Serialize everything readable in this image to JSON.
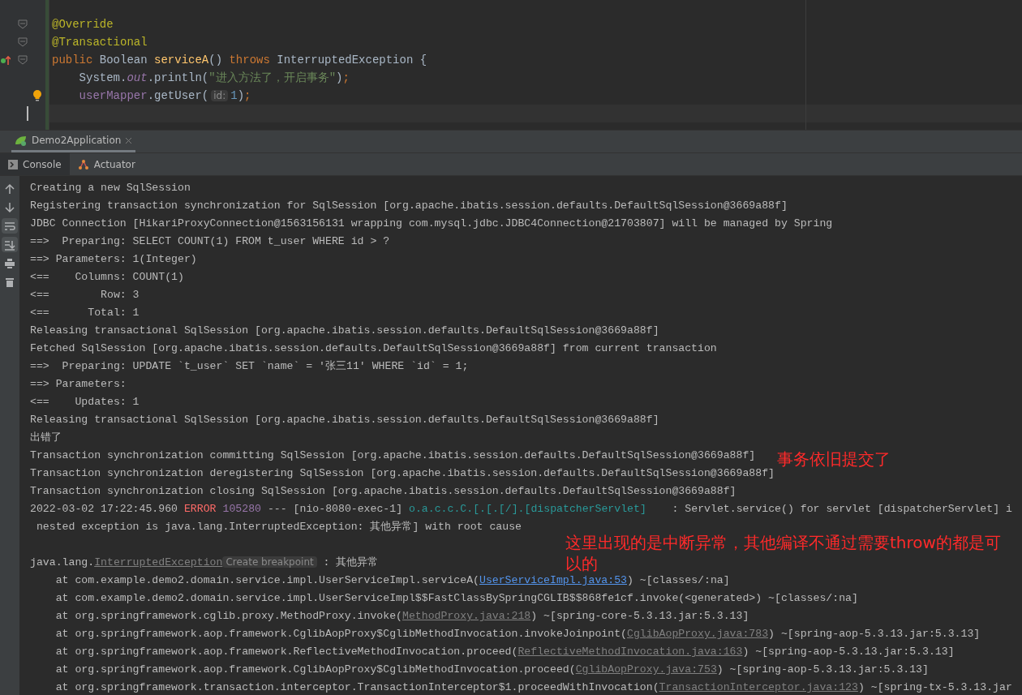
{
  "editor": {
    "lines": [
      {
        "fold": true,
        "current": false,
        "segments": [
          {
            "kind": "annotation",
            "text": "@Override"
          }
        ]
      },
      {
        "fold": true,
        "current": false,
        "segments": [
          {
            "kind": "annotation",
            "text": "@Transactional"
          }
        ]
      },
      {
        "override": true,
        "fold": true,
        "current": false,
        "segments": [
          {
            "kind": "keyword",
            "text": "public "
          },
          {
            "kind": "plain",
            "text": "Boolean "
          },
          {
            "kind": "method",
            "text": "serviceA"
          },
          {
            "kind": "plain",
            "text": "() "
          },
          {
            "kind": "keyword",
            "text": "throws "
          },
          {
            "kind": "plain",
            "text": "InterruptedException {"
          }
        ]
      },
      {
        "current": false,
        "segments": [
          {
            "kind": "plain",
            "text": "    System."
          },
          {
            "kind": "static",
            "text": "out"
          },
          {
            "kind": "plain",
            "text": ".println("
          },
          {
            "kind": "string",
            "text": "\"进入方法了，开启事务\""
          },
          {
            "kind": "plain",
            "text": ")"
          },
          {
            "kind": "keyword",
            "text": ";"
          }
        ]
      },
      {
        "bulb": true,
        "current": false,
        "segments": [
          {
            "kind": "member",
            "text": "    userMapper"
          },
          {
            "kind": "plain",
            "text": ".getUser("
          },
          {
            "kind": "hint",
            "text": "id:"
          },
          {
            "kind": "number",
            "text": "1"
          },
          {
            "kind": "plain",
            "text": ")"
          },
          {
            "kind": "keyword",
            "text": ";"
          }
        ]
      },
      {
        "current": true
      }
    ]
  },
  "run_tabs": [
    {
      "label": "Demo2Application",
      "selected": true
    }
  ],
  "tool_tabs": [
    {
      "label": "Console",
      "kind": "console",
      "selected": true
    },
    {
      "label": "Actuator",
      "kind": "actuator",
      "selected": false
    }
  ],
  "console_toolbar": [
    {
      "kind": "up",
      "on": false
    },
    {
      "kind": "down",
      "on": false
    },
    {
      "kind": "wrap",
      "on": true
    },
    {
      "kind": "scroll",
      "on": true
    },
    {
      "kind": "print",
      "on": false
    },
    {
      "kind": "trash",
      "on": false
    }
  ],
  "console_lines": [
    {
      "segments": [
        {
          "kind": "plain",
          "text": "Creating a new SqlSession"
        }
      ]
    },
    {
      "segments": [
        {
          "kind": "plain",
          "text": "Registering transaction synchronization for SqlSession [org.apache.ibatis.session.defaults.DefaultSqlSession@3669a88f]"
        }
      ]
    },
    {
      "segments": [
        {
          "kind": "plain",
          "text": "JDBC Connection [HikariProxyConnection@1563156131 wrapping com.mysql.jdbc.JDBC4Connection@21703807] will be managed by Spring"
        }
      ]
    },
    {
      "segments": [
        {
          "kind": "plain",
          "text": "==>  Preparing: SELECT COUNT(1) FROM t_user WHERE id > ?"
        }
      ]
    },
    {
      "segments": [
        {
          "kind": "plain",
          "text": "==> Parameters: 1(Integer)"
        }
      ]
    },
    {
      "segments": [
        {
          "kind": "plain",
          "text": "<==    Columns: COUNT(1)"
        }
      ]
    },
    {
      "segments": [
        {
          "kind": "plain",
          "text": "<==        Row: 3"
        }
      ]
    },
    {
      "segments": [
        {
          "kind": "plain",
          "text": "<==      Total: 1"
        }
      ]
    },
    {
      "segments": [
        {
          "kind": "plain",
          "text": "Releasing transactional SqlSession [org.apache.ibatis.session.defaults.DefaultSqlSession@3669a88f]"
        }
      ]
    },
    {
      "segments": [
        {
          "kind": "plain",
          "text": "Fetched SqlSession [org.apache.ibatis.session.defaults.DefaultSqlSession@3669a88f] from current transaction"
        }
      ]
    },
    {
      "segments": [
        {
          "kind": "plain",
          "text": "==>  Preparing: UPDATE `t_user` SET `name` = '张三11' WHERE `id` = 1;"
        }
      ]
    },
    {
      "segments": [
        {
          "kind": "plain",
          "text": "==> Parameters:"
        }
      ]
    },
    {
      "segments": [
        {
          "kind": "plain",
          "text": "<==    Updates: 1"
        }
      ]
    },
    {
      "segments": [
        {
          "kind": "plain",
          "text": "Releasing transactional SqlSession [org.apache.ibatis.session.defaults.DefaultSqlSession@3669a88f]"
        }
      ]
    },
    {
      "segments": [
        {
          "kind": "plain",
          "text": "出错了"
        }
      ]
    },
    {
      "segments": [
        {
          "kind": "plain",
          "text": "Transaction synchronization committing SqlSession [org.apache.ibatis.session.defaults.DefaultSqlSession@3669a88f]"
        }
      ]
    },
    {
      "segments": [
        {
          "kind": "plain",
          "text": "Transaction synchronization deregistering SqlSession [org.apache.ibatis.session.defaults.DefaultSqlSession@3669a88f]"
        }
      ]
    },
    {
      "segments": [
        {
          "kind": "plain",
          "text": "Transaction synchronization closing SqlSession [org.apache.ibatis.session.defaults.DefaultSqlSession@3669a88f]"
        }
      ]
    },
    {
      "segments": [
        {
          "kind": "plain",
          "text": "2022-03-02 17:22:45.960 "
        },
        {
          "kind": "error",
          "text": "ERROR"
        },
        {
          "kind": "pid",
          "text": "105280"
        },
        {
          "kind": "plain",
          "text": " --- [nio-8080-exec-1] "
        },
        {
          "kind": "logger",
          "text": "o.a.c.c.C.[.[.[/].[dispatcherServlet]"
        },
        {
          "kind": "plain",
          "text": "    : Servlet.service() for servlet [dispatcherServlet] i"
        }
      ]
    },
    {
      "segments": [
        {
          "kind": "plain",
          "text": " nested exception is java.lang.InterruptedException: 其他异常] with root cause"
        }
      ]
    },
    {
      "kind": "blank"
    },
    {
      "segments": [
        {
          "kind": "plain",
          "text": "java.lang."
        },
        {
          "kind": "lib_link",
          "text": "InterruptedException"
        },
        {
          "kind": "hint",
          "text": "Create breakpoint"
        },
        {
          "kind": "plain",
          "text": " : 其他异常"
        }
      ]
    },
    {
      "segments": [
        {
          "kind": "plain",
          "text": "    at com.example.demo2.domain.service.impl.UserServiceImpl.serviceA("
        },
        {
          "kind": "link",
          "text": "UserServiceImpl.java:53"
        },
        {
          "kind": "plain",
          "text": ") ~[classes/:na]"
        }
      ]
    },
    {
      "segments": [
        {
          "kind": "plain",
          "text": "    at com.example.demo2.domain.service.impl.UserServiceImpl$$FastClassBySpringCGLIB$$868fe1cf.invoke(<generated>) ~[classes/:na]"
        }
      ]
    },
    {
      "segments": [
        {
          "kind": "plain",
          "text": "    at org.springframework.cglib.proxy.MethodProxy.invoke("
        },
        {
          "kind": "lib_link",
          "text": "MethodProxy.java:218"
        },
        {
          "kind": "plain",
          "text": ") ~[spring-core-5.3.13.jar:5.3.13]"
        }
      ]
    },
    {
      "segments": [
        {
          "kind": "plain",
          "text": "    at org.springframework.aop.framework.CglibAopProxy$CglibMethodInvocation.invokeJoinpoint("
        },
        {
          "kind": "lib_link",
          "text": "CglibAopProxy.java:783"
        },
        {
          "kind": "plain",
          "text": ") ~[spring-aop-5.3.13.jar:5.3.13]"
        }
      ]
    },
    {
      "segments": [
        {
          "kind": "plain",
          "text": "    at org.springframework.aop.framework.ReflectiveMethodInvocation.proceed("
        },
        {
          "kind": "lib_link",
          "text": "ReflectiveMethodInvocation.java:163"
        },
        {
          "kind": "plain",
          "text": ") ~[spring-aop-5.3.13.jar:5.3.13]"
        }
      ]
    },
    {
      "segments": [
        {
          "kind": "plain",
          "text": "    at org.springframework.aop.framework.CglibAopProxy$CglibMethodInvocation.proceed("
        },
        {
          "kind": "lib_link",
          "text": "CglibAopProxy.java:753"
        },
        {
          "kind": "plain",
          "text": ") ~[spring-aop-5.3.13.jar:5.3.13]"
        }
      ]
    },
    {
      "segments": [
        {
          "kind": "plain",
          "text": "    at org.springframework.transaction.interceptor.TransactionInterceptor$1.proceedWithInvocation("
        },
        {
          "kind": "lib_link",
          "text": "TransactionInterceptor.java:123"
        },
        {
          "kind": "plain",
          "text": ") ~[spring-tx-5.3.13.jar"
        }
      ]
    }
  ],
  "annotations": [
    {
      "text": "事务依旧提交了"
    },
    {
      "text": "这里出现的是中断异常，其他编译不通过需要throw的都是可以的"
    }
  ]
}
